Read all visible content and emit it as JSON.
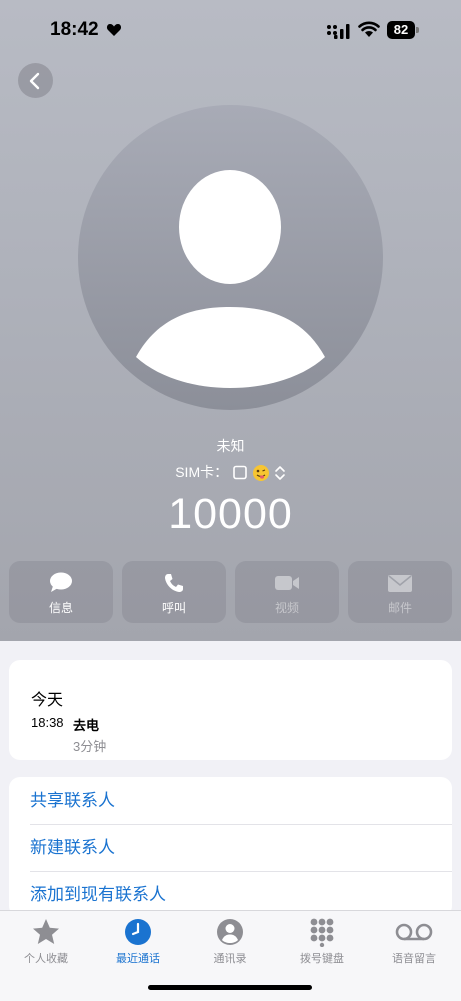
{
  "status_bar": {
    "time": "18:42",
    "battery": "82"
  },
  "contact": {
    "name": "未知",
    "sim_label": "SIM卡：",
    "number": "10000"
  },
  "actions": [
    {
      "label": "信息",
      "icon": "message-icon",
      "enabled": true
    },
    {
      "label": "呼叫",
      "icon": "phone-icon",
      "enabled": true
    },
    {
      "label": "视频",
      "icon": "video-icon",
      "enabled": false
    },
    {
      "label": "邮件",
      "icon": "mail-icon",
      "enabled": false
    }
  ],
  "call_log": {
    "title": "今天",
    "time": "18:38",
    "type": "去电",
    "duration": "3分钟"
  },
  "links": [
    "共享联系人",
    "新建联系人",
    "添加到现有联系人"
  ],
  "tabs": [
    {
      "label": "个人收藏",
      "icon": "star-icon",
      "active": false
    },
    {
      "label": "最近通话",
      "icon": "clock-icon",
      "active": true
    },
    {
      "label": "通讯录",
      "icon": "person-icon",
      "active": false
    },
    {
      "label": "拨号键盘",
      "icon": "keypad-icon",
      "active": false
    },
    {
      "label": "语音留言",
      "icon": "voicemail-icon",
      "active": false
    }
  ],
  "colors": {
    "accent": "#1a73d0",
    "hero_bg": "#aeb1ba",
    "page_bg": "#f1f1f6"
  }
}
